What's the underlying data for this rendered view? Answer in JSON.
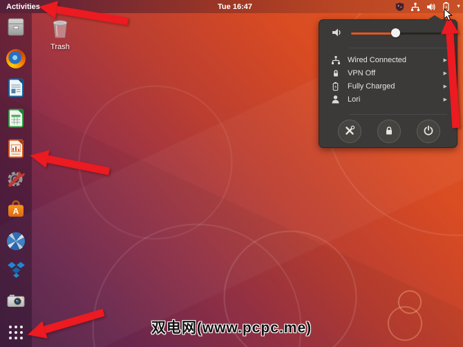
{
  "topbar": {
    "activities_label": "Activities",
    "clock": "Tue 16:47",
    "caret_glyph": "▼",
    "tray_icons": [
      "shield-icon",
      "wired-network-icon",
      "volume-icon",
      "battery-icon",
      "dropdown-caret-icon"
    ]
  },
  "desktop": {
    "trash_label": "Trash",
    "watermark_text": "双电网(www.pcpc.me)"
  },
  "dock": {
    "items": [
      {
        "icon": "files-icon"
      },
      {
        "icon": "firefox-icon"
      },
      {
        "icon": "libreoffice-writer-icon"
      },
      {
        "icon": "libreoffice-calc-icon"
      },
      {
        "icon": "libreoffice-impress-icon"
      },
      {
        "icon": "settings-tools-icon"
      },
      {
        "icon": "ubuntu-software-icon"
      },
      {
        "icon": "photos-pinwheel-icon"
      },
      {
        "icon": "dropbox-icon"
      },
      {
        "icon": "camera-icon"
      },
      {
        "icon": "show-applications-icon"
      }
    ]
  },
  "system_menu": {
    "volume_percent": 46,
    "submenu_arrow": "▶",
    "items": [
      {
        "icon": "wired-network-icon",
        "label": "Wired Connected",
        "has_submenu": true
      },
      {
        "icon": "vpn-lock-icon",
        "label": "VPN Off",
        "has_submenu": true
      },
      {
        "icon": "battery-icon",
        "label": "Fully Charged",
        "has_submenu": true
      },
      {
        "icon": "user-icon",
        "label": "Lori",
        "has_submenu": true
      }
    ],
    "buttons": [
      {
        "icon": "settings-icon"
      },
      {
        "icon": "lock-icon"
      },
      {
        "icon": "power-icon"
      }
    ]
  },
  "annotations": {
    "arrow_color": "#EC1A21",
    "arrows": [
      {
        "target": "activities-button"
      },
      {
        "target": "dock"
      },
      {
        "target": "show-applications-button"
      },
      {
        "target": "system-menu-caret"
      }
    ]
  },
  "colors": {
    "accent_orange": "#E95420",
    "panel_bg": "#3B3A39",
    "topbar_left": "#54203A",
    "topbar_right": "#C95126",
    "wallpaper_top_right": "#E65A22",
    "wallpaper_bottom_left": "#4D2147"
  }
}
